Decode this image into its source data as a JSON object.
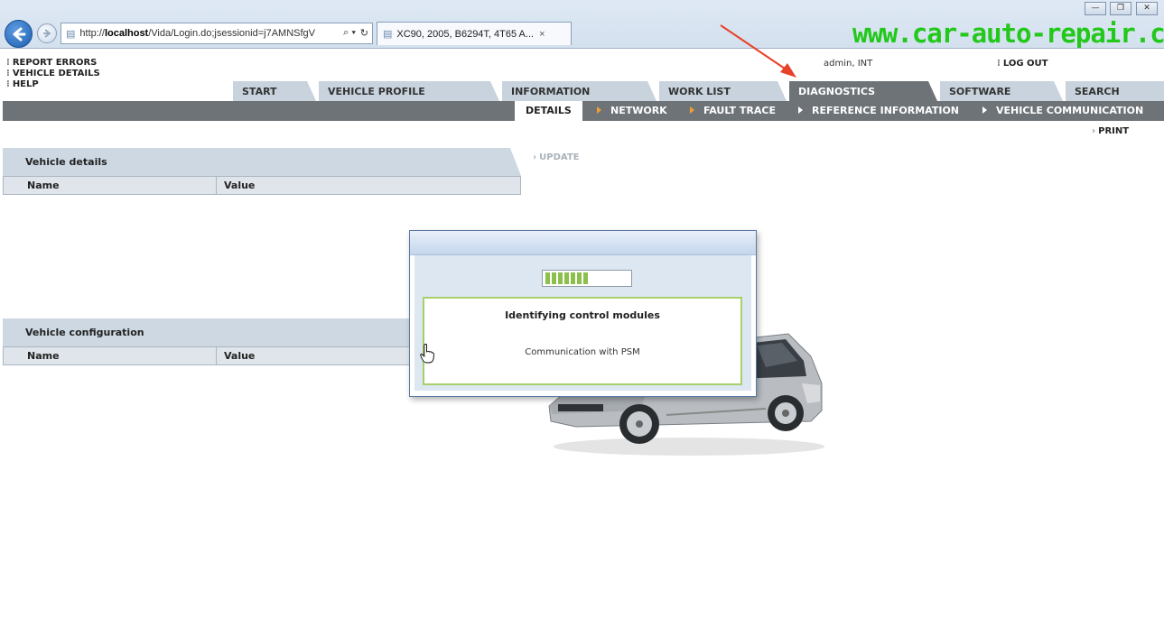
{
  "browser": {
    "url_prefix": "http://",
    "url_host": "localhost",
    "url_rest": "/Vida/Login.do;jsessionid=j7AMNSfgV",
    "tab_title": "XC90, 2005, B6294T, 4T65 A...",
    "tab_close": "×",
    "search_glyph": "⌕ ▾",
    "refresh_glyph": "↻",
    "window_minimize": "—",
    "window_restore": "❐",
    "window_close": "✕",
    "watermark": "www.car-auto-repair.com"
  },
  "left_links": [
    "REPORT ERRORS",
    "VEHICLE DETAILS",
    "HELP"
  ],
  "user": {
    "name": "admin, INT",
    "logout": "LOG OUT"
  },
  "main_tabs": [
    "START",
    "VEHICLE PROFILE",
    "INFORMATION",
    "WORK LIST",
    "DIAGNOSTICS",
    "SOFTWARE",
    "SEARCH"
  ],
  "active_tab": "DIAGNOSTICS",
  "sub_tabs": [
    "DETAILS",
    "NETWORK",
    "FAULT TRACE",
    "REFERENCE INFORMATION",
    "VEHICLE COMMUNICATION"
  ],
  "active_sub_tab": "DETAILS",
  "print_label": "PRINT",
  "update_label": "UPDATE",
  "vehicle_details": {
    "title": "Vehicle details",
    "columns": [
      "Name",
      "Value"
    ]
  },
  "vehicle_configuration": {
    "title": "Vehicle configuration",
    "columns": [
      "Name",
      "Value"
    ]
  },
  "dialog": {
    "progress": 0.5,
    "title": "Identifying control modules",
    "status": "Communication with PSM"
  },
  "colors": {
    "active_tab": "#6e7378",
    "progress": "#8cbf4c",
    "arrow": "#e8412a",
    "watermark": "#22c81a"
  }
}
